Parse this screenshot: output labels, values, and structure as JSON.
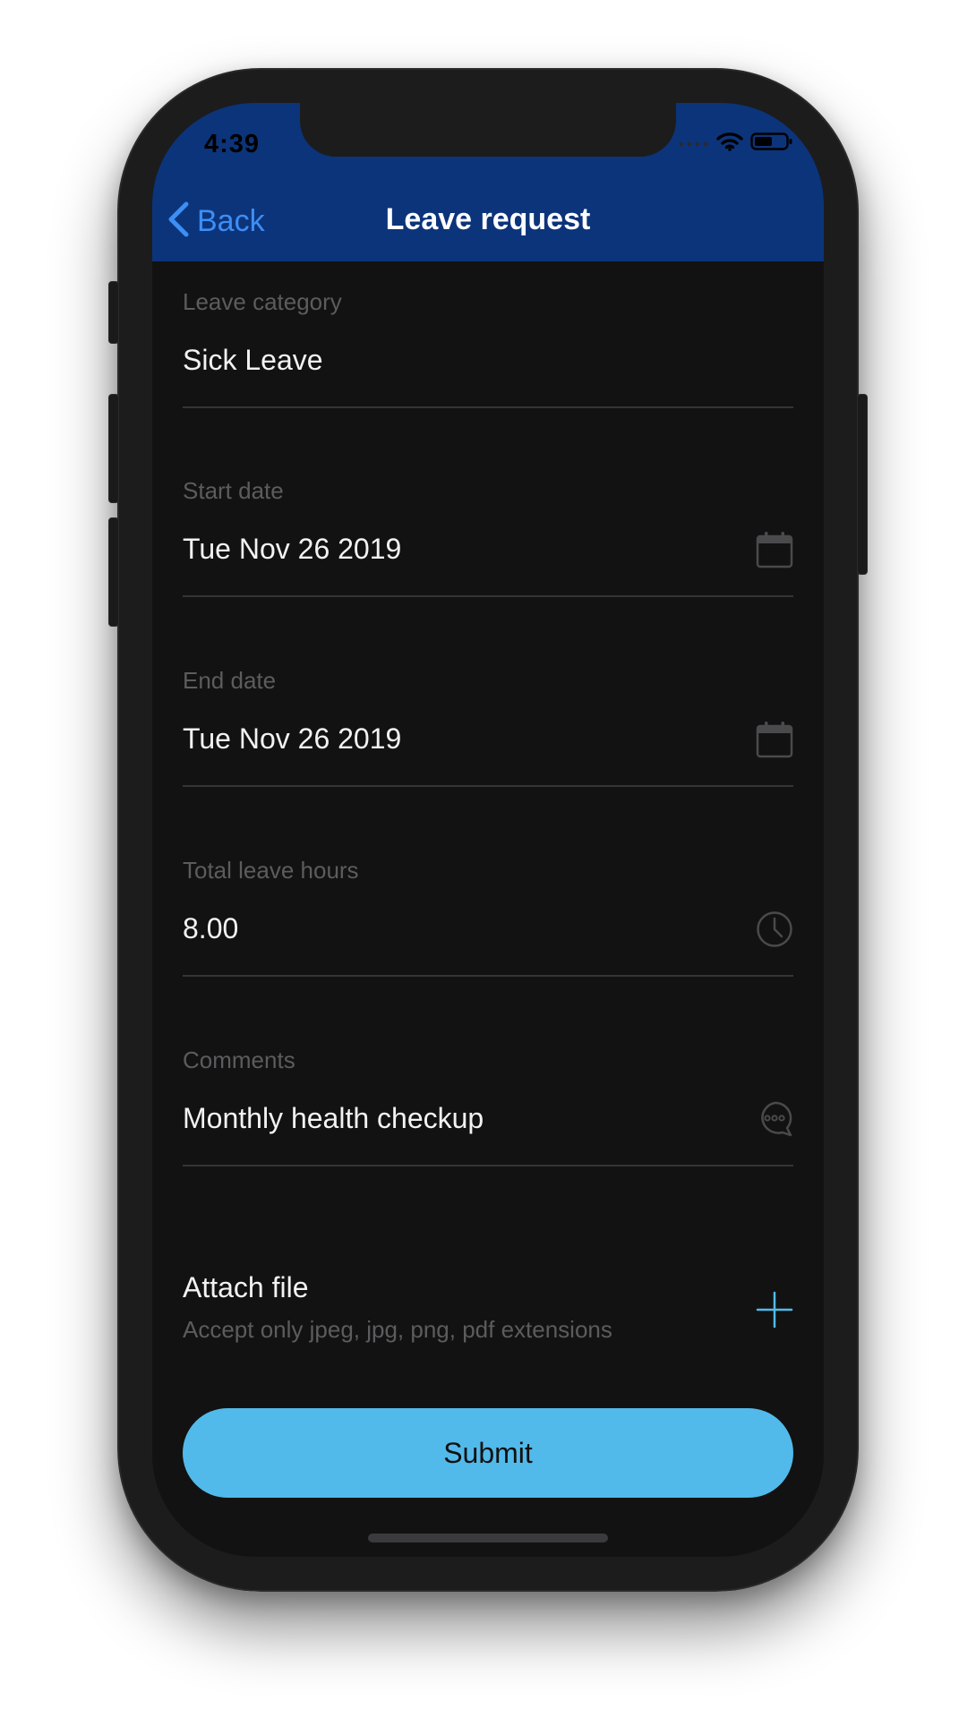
{
  "status_bar": {
    "time": "4:39",
    "icons": [
      "signal-dots-icon",
      "wifi-icon",
      "battery-icon"
    ]
  },
  "nav": {
    "back_label": "Back",
    "title": "Leave request",
    "colors": {
      "bar": "#0c347a",
      "back": "#3d8ef5",
      "title": "#ffffff"
    }
  },
  "form": {
    "leave_category": {
      "label": "Leave category",
      "value": "Sick Leave"
    },
    "start_date": {
      "label": "Start date",
      "value": "Tue Nov 26 2019",
      "icon": "calendar-icon"
    },
    "end_date": {
      "label": "End date",
      "value": "Tue Nov 26 2019",
      "icon": "calendar-icon"
    },
    "total_hours": {
      "label": "Total leave hours",
      "value": "8.00",
      "icon": "clock-icon"
    },
    "comments": {
      "label": "Comments",
      "value": "Monthly health checkup",
      "icon": "chat-bubble-icon"
    }
  },
  "attach": {
    "title": "Attach file",
    "subtitle": "Accept only jpeg, jpg, png, pdf extensions",
    "icon": "plus-icon"
  },
  "submit": {
    "label": "Submit",
    "color": "#52baea"
  },
  "theme": {
    "background": "#121212",
    "label_color": "#5c5c5e",
    "value_color": "#f2f2f2",
    "divider_color": "#353537"
  }
}
